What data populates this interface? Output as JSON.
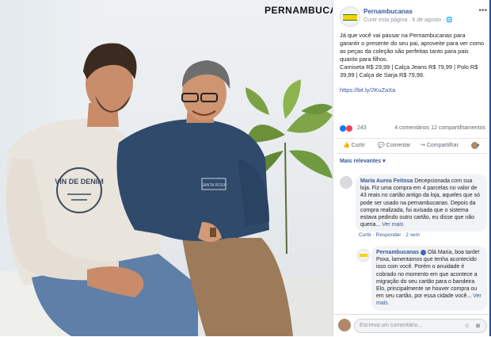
{
  "photo": {
    "brand_text": "PERNAMBUCANAS",
    "shirt_print": "VIN DE DENIM",
    "polo_logo": "SANTA ROSA"
  },
  "page": {
    "name": "Pernambucanas",
    "subline": "Curtir esta página · 6 de agosto · 🌐",
    "menu": "•••"
  },
  "post": {
    "text": "Já que você vai passar na Pernambucanas para garantir o presente do seu pai, aproveite para ver como as peças da coleção são perfeitas tanto para pais quanto para filhos.",
    "prices": "Camiseta R$ 29,99 | Calça Jeans R$ 79,99 | Polo R$ 39,99 | Calça de Sarja R$ 79,99.",
    "link": "https://bit.ly/2KuZaXa"
  },
  "reactions": {
    "count": "243",
    "summary": "4 comentários  12 compartilhamentos"
  },
  "actions": {
    "like": "Curtir",
    "comment": "Comentar",
    "share": "Compartilhar"
  },
  "comments_sort": "Mais relevantes ▾",
  "comments": [
    {
      "author": "Maria Aurea Feitosa",
      "text": "Decepcionada com sua loja. Fiz uma compra em 4 parcelas no valor de 43 reais no cartão antigo da loja, aqueles que só pode ser usado na pernambucanas. Depois da compra realizada, fui avisada que o sistema estava pedindo outro cartão, eu disse que não queria...",
      "more": "Ver mais",
      "links": "Curtir · Responder · 2 sem"
    },
    {
      "author": "Pernambucanas",
      "text": "Olá Maria, boa tarde! Poxa, lamentamos que tenha acontecido isso com você. Porém o anuidade é cobrado no momento em que acontece a migração do seu cartão para o bandeira Elo, principalmente se houver compra ou em seu cartão, por essa cidade você...",
      "more": "Ver mais"
    }
  ],
  "write_comment": {
    "placeholder": "Escreva um comentário..."
  },
  "colors": {
    "link_blue": "#385898",
    "like_blue": "#1877f2",
    "love_red": "#f33e58",
    "brand_yellow": "#f5d400"
  }
}
